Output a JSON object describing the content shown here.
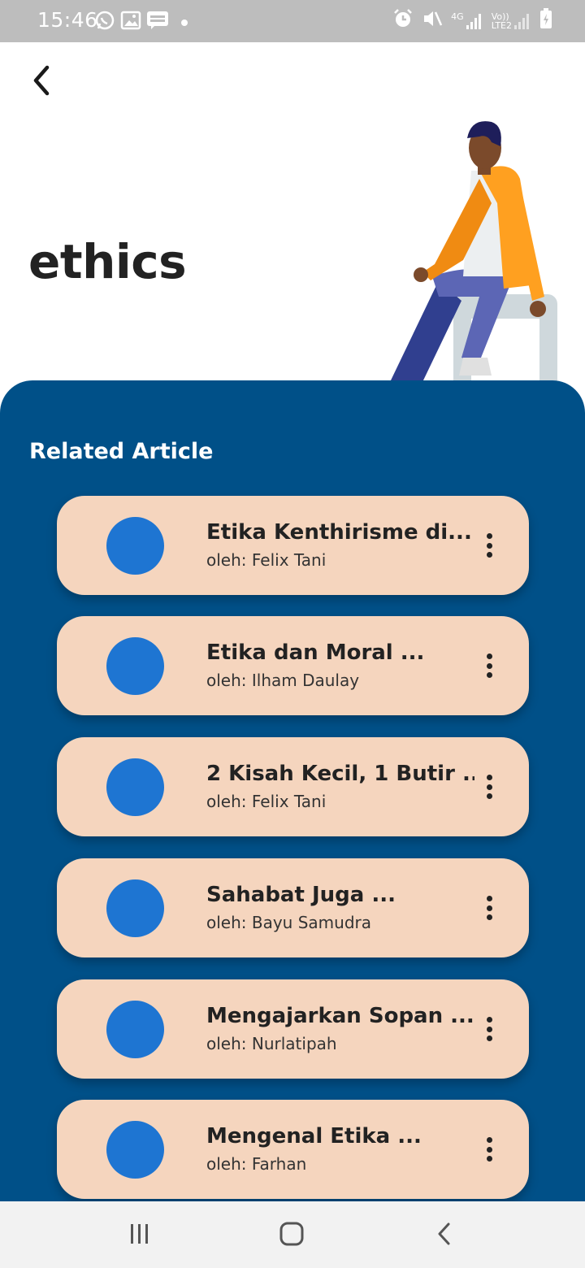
{
  "status_bar": {
    "time": "15:46",
    "left_icons": [
      "whatsapp-icon",
      "gallery-icon",
      "webtoon-icon",
      "notification-dot-icon"
    ],
    "right_icons": [
      "alarm-icon",
      "mute-icon",
      "signal-4g-icon",
      "volte-lte2-icon",
      "battery-charging-icon"
    ],
    "network_4g": "4G",
    "volte_label": "Vo))",
    "lte_label": "LTE2"
  },
  "header": {
    "back_icon": "chevron-left-icon",
    "title": "ethics"
  },
  "panel": {
    "color": "#005088",
    "section_title": "Related Article",
    "articles": [
      {
        "title": "Etika Kenthirisme di...",
        "author": "oleh: Felix Tani"
      },
      {
        "title": "Etika dan Moral ...",
        "author": "oleh: Ilham Daulay"
      },
      {
        "title": "2 Kisah Kecil, 1 Butir ...",
        "author": "oleh: Felix Tani"
      },
      {
        "title": "Sahabat Juga ...",
        "author": "oleh: Bayu Samudra"
      },
      {
        "title": "Mengajarkan Sopan ...",
        "author": "oleh: Nurlatipah"
      },
      {
        "title": "Mengenal Etika ...",
        "author": "oleh: Farhan"
      }
    ]
  },
  "colors": {
    "card_background": "#f5d5be",
    "thumbnail": "#1e75d2",
    "title_text": "#222222"
  },
  "nav_bar": {
    "icons": [
      "recent-apps-icon",
      "home-icon",
      "back-nav-icon"
    ]
  }
}
